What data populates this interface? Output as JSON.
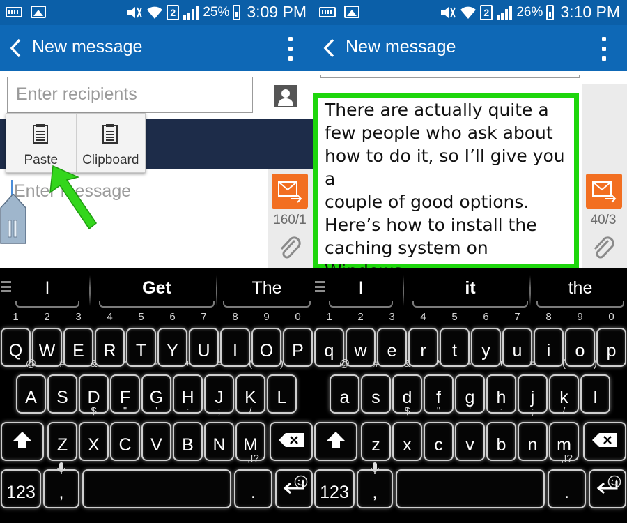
{
  "colors": {
    "status_bar": "#0b5fa8",
    "action_bar": "#0e68b6",
    "send": "#f26f21",
    "highlight": "#1ed60c",
    "compose_strip": "#1d2c49"
  },
  "left": {
    "status": {
      "battery": "25%",
      "time": "3:09 PM",
      "sim": "2"
    },
    "header": {
      "title": "New message"
    },
    "recipients": {
      "placeholder": "Enter recipients"
    },
    "popup": {
      "paste": "Paste",
      "clipboard": "Clipboard"
    },
    "compose": {
      "placeholder": "Enter message",
      "counter": "160/1"
    },
    "suggestions": [
      "I",
      "Get",
      "The"
    ]
  },
  "right": {
    "status": {
      "battery": "26%",
      "time": "3:10 PM",
      "sim": "2"
    },
    "header": {
      "title": "New message"
    },
    "compose": {
      "lines": [
        "There are actually quite a",
        "few people who ask about",
        "how to do it, so I’ll give you a",
        "couple of good options.",
        "Here’s how to install the",
        "caching system on",
        "Windows."
      ],
      "counter": "40/3"
    },
    "suggestions": [
      "I",
      "it",
      "the"
    ]
  },
  "keyboard": {
    "row1_hints": [
      "1",
      "2",
      "3",
      "4",
      "5",
      "6",
      "7",
      "8",
      "9",
      "0"
    ],
    "row1_upper": [
      "Q",
      "W",
      "E",
      "R",
      "T",
      "Y",
      "U",
      "I",
      "O",
      "P"
    ],
    "row1_lower": [
      "q",
      "w",
      "e",
      "r",
      "t",
      "y",
      "u",
      "i",
      "o",
      "p"
    ],
    "row2_hints": [
      "@",
      "#",
      "&",
      "*",
      "-",
      "+",
      "=",
      "(",
      ")"
    ],
    "row2_upper": [
      "A",
      "S",
      "D",
      "F",
      "G",
      "H",
      "J",
      "K",
      "L"
    ],
    "row2_lower": [
      "a",
      "s",
      "d",
      "f",
      "g",
      "h",
      "j",
      "k",
      "l"
    ],
    "row3_hints": [
      "$",
      "\"",
      "'",
      ":",
      ";",
      "/"
    ],
    "row3_upper": [
      "Z",
      "X",
      "C",
      "V",
      "B",
      "N",
      "M"
    ],
    "row3_lower": [
      "z",
      "x",
      "c",
      "v",
      "b",
      "n",
      "m"
    ],
    "num_label": "123",
    "comma": ",",
    "period": ".",
    "punct_hint": ",!?"
  }
}
